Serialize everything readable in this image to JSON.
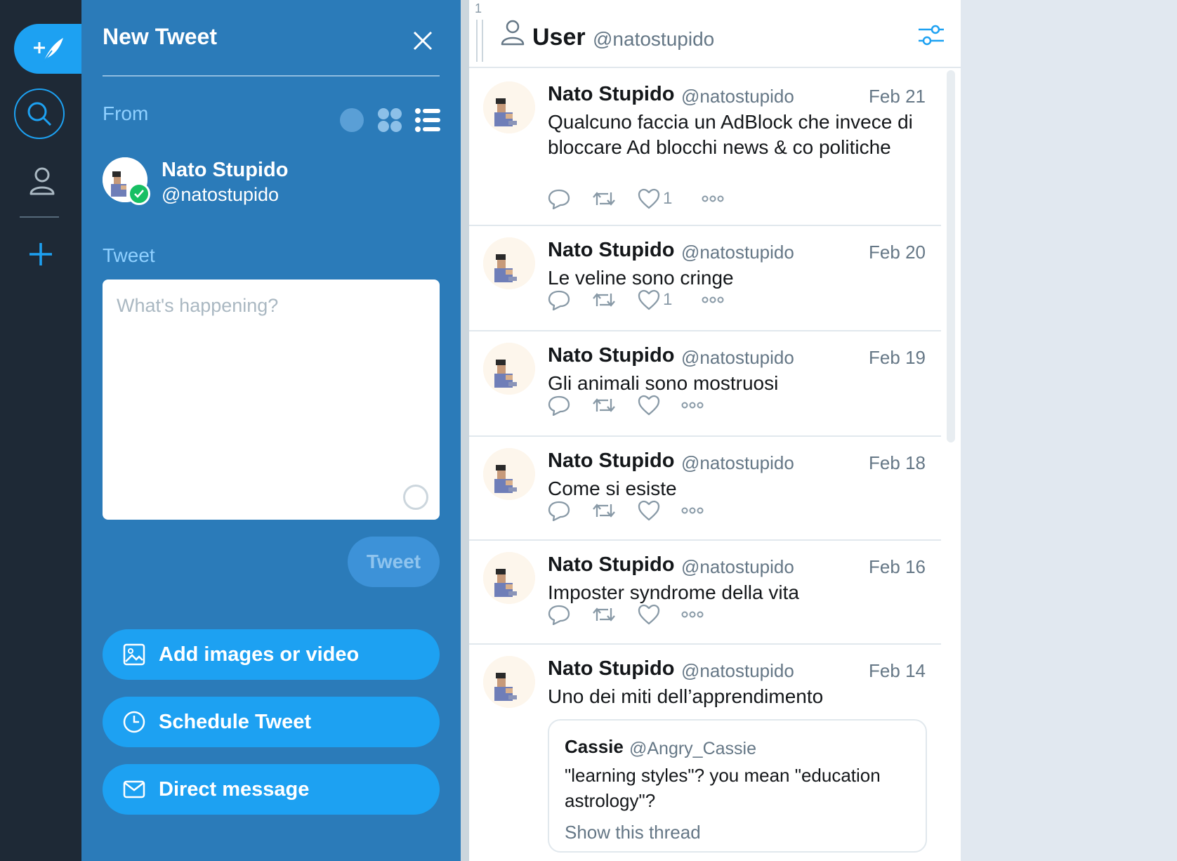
{
  "colors": {
    "nav_bg": "#1e2936",
    "compose_bg": "#2b7bb9",
    "accent": "#1da1f2",
    "verified": "#17bf63",
    "page_bg": "#e1e8f0"
  },
  "nav": {
    "items": [
      {
        "name": "compose",
        "icon": "feather-plus-icon"
      },
      {
        "name": "search",
        "icon": "search-icon"
      },
      {
        "name": "profile",
        "icon": "user-icon"
      },
      {
        "name": "add-column",
        "icon": "plus-icon"
      }
    ]
  },
  "compose": {
    "title": "New Tweet",
    "from_label": "From",
    "account": {
      "name": "Nato Stupido",
      "handle": "@natostupido"
    },
    "tweet_label": "Tweet",
    "placeholder": "What's happening?",
    "submit_label": "Tweet",
    "actions": {
      "add_media": "Add images or video",
      "schedule": "Schedule Tweet",
      "dm": "Direct message"
    }
  },
  "column": {
    "number": "1",
    "title": "User",
    "subtitle": "@natostupido",
    "tweets": [
      {
        "name": "Nato Stupido",
        "handle": "@natostupido",
        "date": "Feb 21",
        "text": "Qualcuno faccia un AdBlock che invece di bloccare Ad blocchi news & co politiche",
        "likes": "1"
      },
      {
        "name": "Nato Stupido",
        "handle": "@natostupido",
        "date": "Feb 20",
        "text": "Le veline sono cringe",
        "likes": "1"
      },
      {
        "name": "Nato Stupido",
        "handle": "@natostupido",
        "date": "Feb 19",
        "text": "Gli animali sono mostruosi",
        "likes": ""
      },
      {
        "name": "Nato Stupido",
        "handle": "@natostupido",
        "date": "Feb 18",
        "text": "Come si esiste",
        "likes": ""
      },
      {
        "name": "Nato Stupido",
        "handle": "@natostupido",
        "date": "Feb 16",
        "text": "Imposter syndrome della vita",
        "likes": ""
      },
      {
        "name": "Nato Stupido",
        "handle": "@natostupido",
        "date": "Feb 14",
        "text": "Uno dei miti dell’apprendimento",
        "likes": ""
      }
    ],
    "quote": {
      "name": "Cassie",
      "handle": "@Angry_Cassie",
      "text": "\"learning styles\"? you mean \"education astrology\"?",
      "link": "Show this thread"
    }
  }
}
